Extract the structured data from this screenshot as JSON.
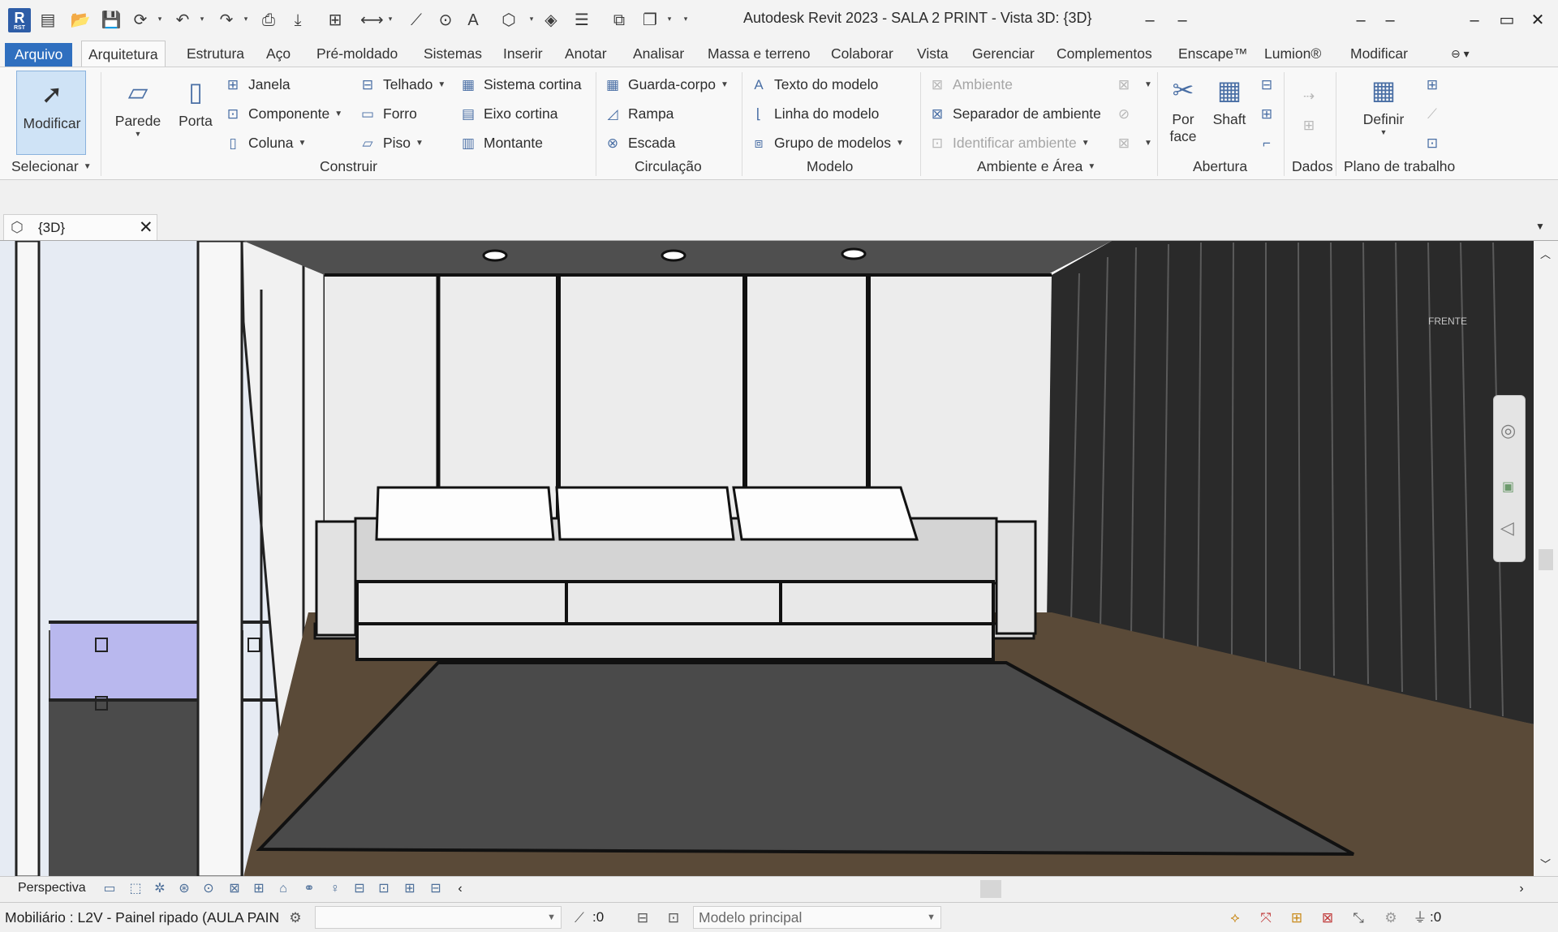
{
  "app": {
    "logo_letter": "R",
    "logo_sub": "RST",
    "window_title": "Autodesk Revit 2023 - SALA 2 PRINT - Vista 3D: {3D}"
  },
  "quick_access": [
    "open-icon",
    "save-icon",
    "sync-icon",
    "undo-icon",
    "redo-icon",
    "print-icon",
    "export-icon",
    "measure-icon",
    "dimension-icon",
    "tag-icon",
    "text-icon",
    "3d-view-icon",
    "section-icon",
    "thin-lines-icon",
    "switch-windows-icon",
    "customize-icon"
  ],
  "window_buttons": {
    "minimize": "–",
    "restore": "▭",
    "close": "✕"
  },
  "ribbon_tabs": [
    "Arquivo",
    "Arquitetura",
    "Estrutura",
    "Aço",
    "Pré-moldado",
    "Sistemas",
    "Inserir",
    "Anotar",
    "Analisar",
    "Massa e terreno",
    "Colaborar",
    "Vista",
    "Gerenciar",
    "Complementos",
    "Enscape™",
    "Lumion®",
    "Modificar"
  ],
  "ribbon": {
    "selecionar": {
      "modificar": "Modificar",
      "label": "Selecionar"
    },
    "construir": {
      "parede": "Parede",
      "porta": "Porta",
      "janela": "Janela",
      "componente": "Componente",
      "coluna": "Coluna",
      "telhado": "Telhado",
      "forro": "Forro",
      "piso": "Piso",
      "sistema_cortina": "Sistema cortina",
      "eixo_cortina": "Eixo cortina",
      "montante": "Montante",
      "label": "Construir"
    },
    "circulacao": {
      "guarda_corpo": "Guarda-corpo",
      "rampa": "Rampa",
      "escada": "Escada",
      "label": "Circulação"
    },
    "modelo": {
      "texto": "Texto do modelo",
      "linha": "Linha do modelo",
      "grupo": "Grupo de modelos",
      "label": "Modelo"
    },
    "ambiente_area": {
      "ambiente": "Ambiente",
      "separador": "Separador de ambiente",
      "identificar": "Identificar ambiente",
      "label": "Ambiente e Área"
    },
    "abertura": {
      "por_face_1": "Por",
      "por_face_2": "face",
      "shaft": "Shaft",
      "label": "Abertura"
    },
    "dados": {
      "label": "Dados"
    },
    "plano": {
      "definir": "Definir",
      "label": "Plano de trabalho"
    }
  },
  "view_tab": {
    "label": "{3D}",
    "icon": "3d-view-icon"
  },
  "viewport": {
    "viewcube_label": "FRENTE"
  },
  "view_control": {
    "label": "Perspectiva"
  },
  "status": {
    "selection_text": "Mobiliário : L2V - Painel ripado (AULA PAIN",
    "workset_count": ":0",
    "design_option": "Modelo principal",
    "filter_count": ":0"
  }
}
